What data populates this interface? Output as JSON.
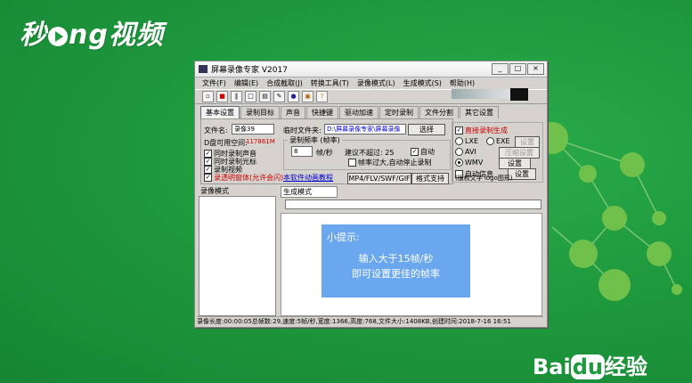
{
  "watermark": {
    "logo": "秒懂视频",
    "brand": "Bai经验"
  },
  "colors": {
    "background": "#1f9a3e",
    "tip_box": "#6aa7ee",
    "red_text": "#cc0000",
    "link_blue": "#0000cc"
  },
  "window": {
    "title": "屏幕录像专家 V2017",
    "controls": [
      "minimize-icon",
      "maximize-icon",
      "close-icon"
    ],
    "menu": [
      "文件(F)",
      "编辑(E)",
      "合成截取(J)",
      "转换工具(T)",
      "录像模式(L)",
      "生成模式(S)",
      "帮助(H)"
    ],
    "toolbar_icons": [
      "new-icon",
      "record-icon",
      "pause-icon",
      "stop-icon",
      "folder-icon",
      "tool-icon",
      "globe-icon",
      "lock-icon",
      "help-icon"
    ],
    "tabs": [
      "基本设置",
      "录制目标",
      "声音",
      "快捷键",
      "驱动加速",
      "定时录制",
      "文件分割",
      "其它设置"
    ],
    "basic": {
      "filename_label": "文件名:",
      "filename_value": "录像39",
      "temp_folder_label": "临时文件夹:",
      "temp_folder_value": "D:\\屏幕录像专家\\屏幕录像",
      "select_button": "选择",
      "disk_space_label": "D盘可用空间:",
      "disk_space_value": "117861M",
      "checks": [
        {
          "label": "同时录制声音",
          "checked": true
        },
        {
          "label": "同时录制光标",
          "checked": true
        },
        {
          "label": "录制视频",
          "checked": true
        },
        {
          "label": "录透明窗体(允许会闪)",
          "checked": true
        }
      ],
      "tutorial_link": "本软件动画教程",
      "frame_group_label": "录制频率 (帧率)",
      "fps_value": "8",
      "fps_unit": "帧/秒",
      "suggest_label": "建议不超过: 25",
      "auto_label": "自动",
      "auto_checked": true,
      "frame_stop_label": "帧率过大,自动停止录制",
      "frame_stop_checked": false,
      "format_label": "MP4/FLV/SWF/GIF",
      "format_support_button": "格式支持"
    },
    "generate": {
      "direct_label": "直接录制生成",
      "direct_checked": true,
      "options": [
        {
          "label": "LXE",
          "selected": false
        },
        {
          "label": "EXE",
          "selected": false
        },
        {
          "label": "AVI",
          "selected": false
        },
        {
          "label": "WMV",
          "selected": true
        }
      ],
      "settings_button": "设置",
      "compress_button": "压缩设置",
      "settings2_button": "设置",
      "auto_info_label": "自动信息",
      "auto_info_checked": false,
      "settings3_button": "设置",
      "copyright_text": "(版权文字 logo图形)"
    },
    "mode_panel": {
      "record_mode_header": "录像模式",
      "generate_mode_header": "生成模式"
    },
    "tip": {
      "title": "小提示:",
      "line1": "输入大于15帧/秒",
      "line2": "即可设置更佳的帧率"
    },
    "status": "录像长度:00:00:05总帧数:29,速度:5帧/秒,宽度:1366,高度:768,文件大小:1408KB,创建时间:2018-7-16 16:51"
  }
}
